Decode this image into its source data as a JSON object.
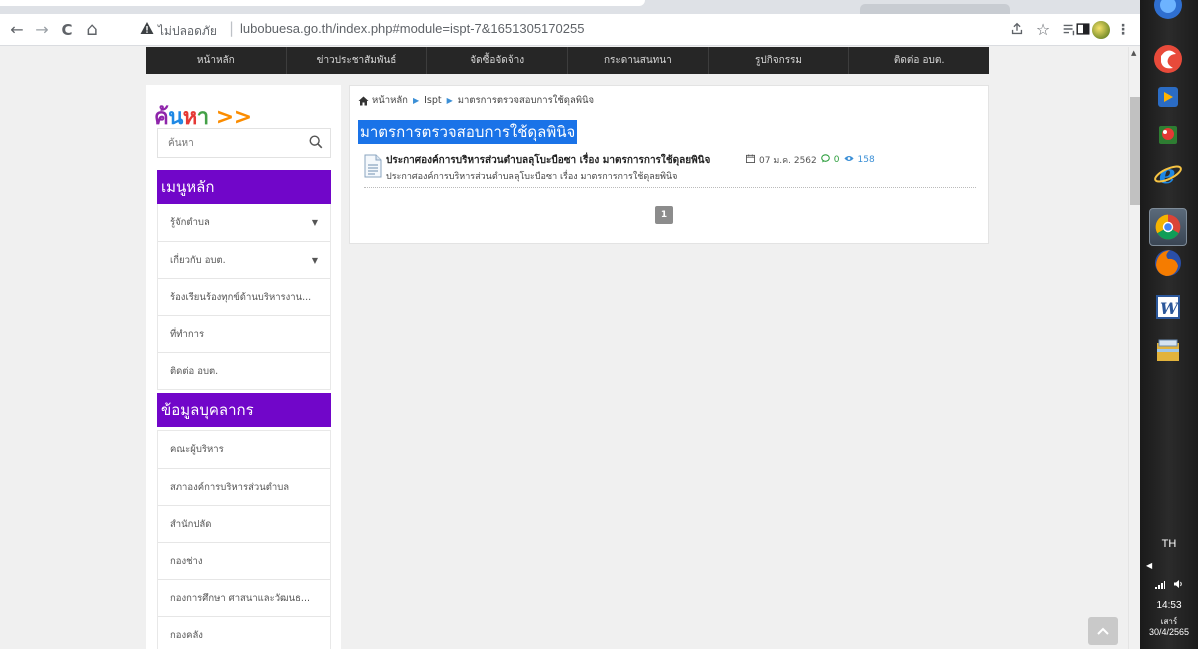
{
  "browser": {
    "not_secure_label": "ไม่ปลอดภัย",
    "url": "lubobuesa.go.th/index.php#module=ispt-7&1651305170255",
    "nav": {
      "back": "←",
      "forward": "→",
      "reload": "C",
      "home": "⌂"
    },
    "toolbar_icons": [
      "share-icon",
      "bookmark-star-icon",
      "reading-list-icon",
      "side-panel-icon",
      "profile-avatar",
      "kebab-menu-icon"
    ]
  },
  "topnav": {
    "items": [
      "หน้าหลัก",
      "ข่าวประชาสัมพันธ์",
      "จัดซื้อจัดจ้าง",
      "กระดานสนทนา",
      "รูปกิจกรรม",
      "ติดต่อ อบต."
    ]
  },
  "sidebar": {
    "search_heading": {
      "a": "ค้",
      "b": "น",
      "c": "ห",
      "d": "า",
      "e": " >>"
    },
    "search_placeholder": "ค้นหา",
    "main_menu_title": "เมนูหลัก",
    "main_menu": [
      {
        "label": "รู้จักตำบล",
        "caret": "▼"
      },
      {
        "label": "เกี่ยวกับ อบต.",
        "caret": "▼"
      },
      {
        "label": "ร้องเรียนร้องทุกข์ด้านบริหารงาน..."
      },
      {
        "label": "ที่ทำการ"
      },
      {
        "label": "ติดต่อ อบต."
      }
    ],
    "personnel_title": "ข้อมูลบุคลากร",
    "personnel": [
      {
        "label": "คณะผู้บริหาร"
      },
      {
        "label": "สภาองค์การบริหารส่วนตำบล"
      },
      {
        "label": "สำนักปลัด"
      },
      {
        "label": "กองช่าง"
      },
      {
        "label": "กองการศึกษา ศาสนาและวัฒนธ..."
      },
      {
        "label": "กองคลัง"
      }
    ]
  },
  "content": {
    "breadcrumb": [
      "หน้าหลัก",
      "Ispt",
      "มาตรการตรวจสอบการใช้ดุลพินิจ"
    ],
    "title": "มาตรการตรวจสอบการใช้ดุลพินิจ",
    "entry": {
      "title": "ประกาศองค์การบริหารส่วนตำบลลุโบะบือซา เรื่อง มาตรการการใช้ดุลยพินิจ",
      "date": "07 ม.ค. 2562",
      "comments": "0",
      "views": "158",
      "description": "ประกาศองค์การบริหารส่วนตำบลลุโบะบือซา เรื่อง มาตรการการใช้ดุลยพินิจ"
    },
    "pagination": {
      "current": "1"
    }
  },
  "taskbar": {
    "apps": [
      "app-icon",
      "media-player-icon",
      "mail-icon",
      "internet-explorer-icon",
      "chrome-icon",
      "firefox-icon",
      "word-icon",
      "file-manager-icon"
    ],
    "language": "TH",
    "time": "14:53",
    "day": "เสาร์",
    "date": "30/4/2565"
  },
  "colors": {
    "nav_bg": "#262626",
    "purple_header": "#7106c9",
    "title_highlight": "#1a73e8",
    "link_blue": "#3b8fd6",
    "comment_green": "#2e9e3e"
  }
}
